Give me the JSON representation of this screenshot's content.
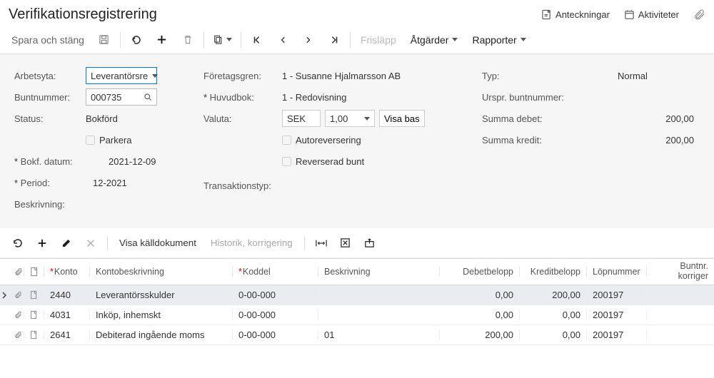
{
  "title": "Verifikationsregistrering",
  "header": {
    "notes": "Anteckningar",
    "activities": "Aktiviteter"
  },
  "toolbar": {
    "save_close": "Spara och stäng",
    "release": "Frisläpp",
    "actions": "Åtgärder",
    "reports": "Rapporter"
  },
  "form": {
    "labels": {
      "workspace": "Arbetsyta:",
      "batch": "Buntnummer:",
      "status": "Status:",
      "park": "Parkera",
      "post_date": "Bokf. datum:",
      "period": "Period:",
      "description": "Beskrivning:",
      "branch": "Företagsgren:",
      "ledger": "Huvudbok:",
      "currency": "Valuta:",
      "show_base": "Visa bas",
      "auto_reverse": "Autoreversering",
      "reversed_batch": "Reverserad bunt",
      "tx_type": "Transaktionstyp:",
      "type": "Typ:",
      "orig_batch": "Urspr. buntnummer:",
      "sum_debit": "Summa debet:",
      "sum_credit": "Summa kredit:"
    },
    "values": {
      "workspace": "Leverantörsre",
      "batch": "000735",
      "status": "Bokförd",
      "post_date": "2021-12-09",
      "period": "12-2021",
      "branch": "1 - Susanne Hjalmarsson AB",
      "ledger": "1 - Redovisning",
      "currency_code": "SEK",
      "currency_rate": "1,00",
      "type": "Normal",
      "sum_debit": "200,00",
      "sum_credit": "200,00"
    }
  },
  "grid_toolbar": {
    "show_source": "Visa källdokument",
    "history": "Historik, korrigering"
  },
  "grid": {
    "headers": {
      "account": "Konto",
      "account_desc": "Kontobeskrivning",
      "segment": "Koddel",
      "descr": "Beskrivning",
      "debit": "Debetbelopp",
      "credit": "Kreditbelopp",
      "seq": "Löpnummer",
      "batch_corr1": "Buntnr.",
      "batch_corr2": "korriger"
    },
    "rows": [
      {
        "selected": true,
        "account": "2440",
        "desc": "Leverantörsskulder",
        "seg": "0-00-000",
        "narr": "",
        "debit": "0,00",
        "credit": "200,00",
        "seq": "200197"
      },
      {
        "selected": false,
        "account": "4031",
        "desc": "Inköp, inhemskt",
        "seg": "0-00-000",
        "narr": "",
        "debit": "0,00",
        "credit": "0,00",
        "seq": "200197"
      },
      {
        "selected": false,
        "account": "2641",
        "desc": "Debiterad ingående moms",
        "seg": "0-00-000",
        "narr": "01",
        "debit": "200,00",
        "credit": "0,00",
        "seq": "200197"
      }
    ]
  }
}
